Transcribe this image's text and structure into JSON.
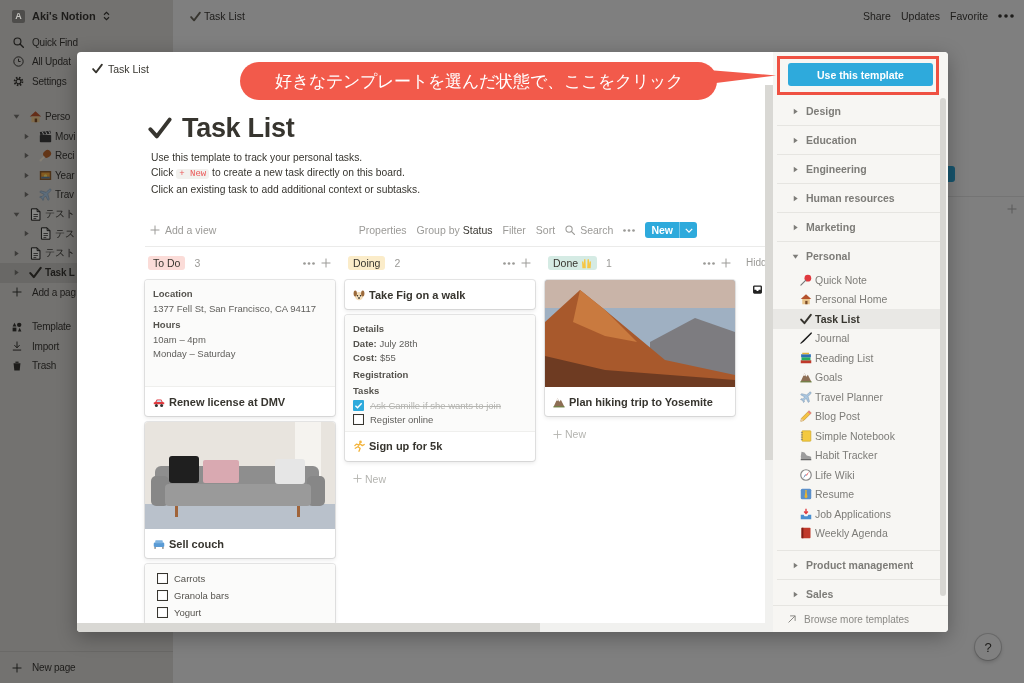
{
  "app": {
    "sidebar": {
      "workspace": {
        "avatar": "A",
        "name": "Aki's Notion"
      },
      "nav": [
        "Quick Find",
        "All Updat",
        "Settings"
      ],
      "pages": [
        {
          "label": "Perso",
          "expanded": true,
          "selected": false,
          "children": [
            {
              "label": "Movi",
              "expanded": false,
              "selected": false
            },
            {
              "label": "Reci",
              "expanded": false,
              "selected": false
            },
            {
              "label": "Year",
              "expanded": false,
              "selected": false
            },
            {
              "label": "Trav",
              "expanded": false,
              "selected": false
            }
          ]
        },
        {
          "label": "テスト",
          "expanded": true,
          "selected": false,
          "children": [
            {
              "label": "テス",
              "expanded": false,
              "selected": false
            }
          ]
        },
        {
          "label": "テスト",
          "expanded": false,
          "selected": false
        },
        {
          "label": "Task L",
          "expanded": false,
          "selected": true
        }
      ],
      "add_page": "Add a pag",
      "tools": [
        "Template",
        "Import",
        "Trash"
      ],
      "new_page": "New page"
    },
    "topbar": {
      "title": "Task List",
      "actions": [
        "Share",
        "Updates",
        "Favorite"
      ]
    },
    "help": "?"
  },
  "modal": {
    "breadcrumb": "Task List",
    "page": {
      "title": "Task List",
      "description": [
        {
          "text": "Use this template to track your personal tasks."
        },
        {
          "text": "Click",
          "code": "+ New",
          "after": "to create a new task directly on this board."
        },
        {
          "text": "Click an existing task to add additional context or subtasks."
        }
      ]
    },
    "toolbar": {
      "add_view": "Add a view",
      "properties": "Properties",
      "group_by": "Group by",
      "group_value": "Status",
      "filter": "Filter",
      "sort": "Sort",
      "search": "Search",
      "new": "New"
    },
    "board": {
      "columns": [
        {
          "name": "To Do",
          "color": "#fbdcd8",
          "count": "3",
          "cards": [
            {
              "kind": "preview",
              "preview": [
                {
                  "kind": "heading",
                  "text": "Location"
                },
                {
                  "kind": "text",
                  "text": "1377 Fell St, San Francisco, CA 94117"
                },
                {
                  "kind": "heading",
                  "text": "Hours"
                },
                {
                  "kind": "text",
                  "text": "10am – 4pm"
                },
                {
                  "kind": "text",
                  "text": "Monday – Saturday"
                }
              ],
              "title": "Renew license at DMV"
            },
            {
              "kind": "photo",
              "title": "Sell couch"
            },
            {
              "kind": "checklist",
              "items": [
                {
                  "text": "Carrots",
                  "checked": false
                },
                {
                  "text": "Granola bars",
                  "checked": false
                },
                {
                  "text": "Yogurt",
                  "checked": false
                }
              ]
            }
          ]
        },
        {
          "name": "Doing",
          "color": "#fbecc9",
          "count": "2",
          "cards": [
            {
              "kind": "plain",
              "title": "Take Fig on a walk"
            },
            {
              "kind": "preview",
              "preview": [
                {
                  "kind": "heading",
                  "text": "Details"
                },
                {
                  "kind": "text",
                  "text": "**Date:** July 28th"
                },
                {
                  "kind": "text",
                  "text": "**Cost:** $55"
                },
                {
                  "kind": "heading",
                  "text": "Registration"
                },
                {
                  "kind": "heading",
                  "text": "Tasks"
                },
                {
                  "kind": "todo",
                  "text": "Ask Camille if she wants to join",
                  "checked": true
                },
                {
                  "kind": "todo",
                  "text": "Register online",
                  "checked": false
                }
              ],
              "title": "Sign up for 5k"
            }
          ],
          "add_new": "New"
        },
        {
          "name": "Done",
          "color": "#d5ebe4",
          "count": "1",
          "cards": [
            {
              "kind": "photo",
              "title": "Plan hiking trip to Yosemite"
            }
          ],
          "add_new": "New"
        }
      ],
      "hidden_column": "Hidd"
    },
    "templates": {
      "use_button": "Use this template",
      "categories": [
        {
          "label": "Design",
          "expanded": false
        },
        {
          "label": "Education",
          "expanded": false
        },
        {
          "label": "Engineering",
          "expanded": false
        },
        {
          "label": "Human resources",
          "expanded": false
        },
        {
          "label": "Marketing",
          "expanded": false
        },
        {
          "label": "Personal",
          "expanded": true,
          "children": [
            {
              "label": "Quick Note",
              "selected": false
            },
            {
              "label": "Personal Home",
              "selected": false
            },
            {
              "label": "Task List",
              "selected": true
            },
            {
              "label": "Journal",
              "selected": false
            },
            {
              "label": "Reading List",
              "selected": false
            },
            {
              "label": "Goals",
              "selected": false
            },
            {
              "label": "Travel Planner",
              "selected": false
            },
            {
              "label": "Blog Post",
              "selected": false
            },
            {
              "label": "Simple Notebook",
              "selected": false
            },
            {
              "label": "Habit Tracker",
              "selected": false
            },
            {
              "label": "Life Wiki",
              "selected": false
            },
            {
              "label": "Resume",
              "selected": false
            },
            {
              "label": "Job Applications",
              "selected": false
            },
            {
              "label": "Weekly Agenda",
              "selected": false
            }
          ]
        },
        {
          "label": "Product management",
          "expanded": false
        },
        {
          "label": "Sales",
          "expanded": false
        }
      ],
      "browse": "Browse more templates"
    }
  },
  "annotation": {
    "callout": "好きなテンプレートを選んだ状態で、ここをクリック"
  }
}
